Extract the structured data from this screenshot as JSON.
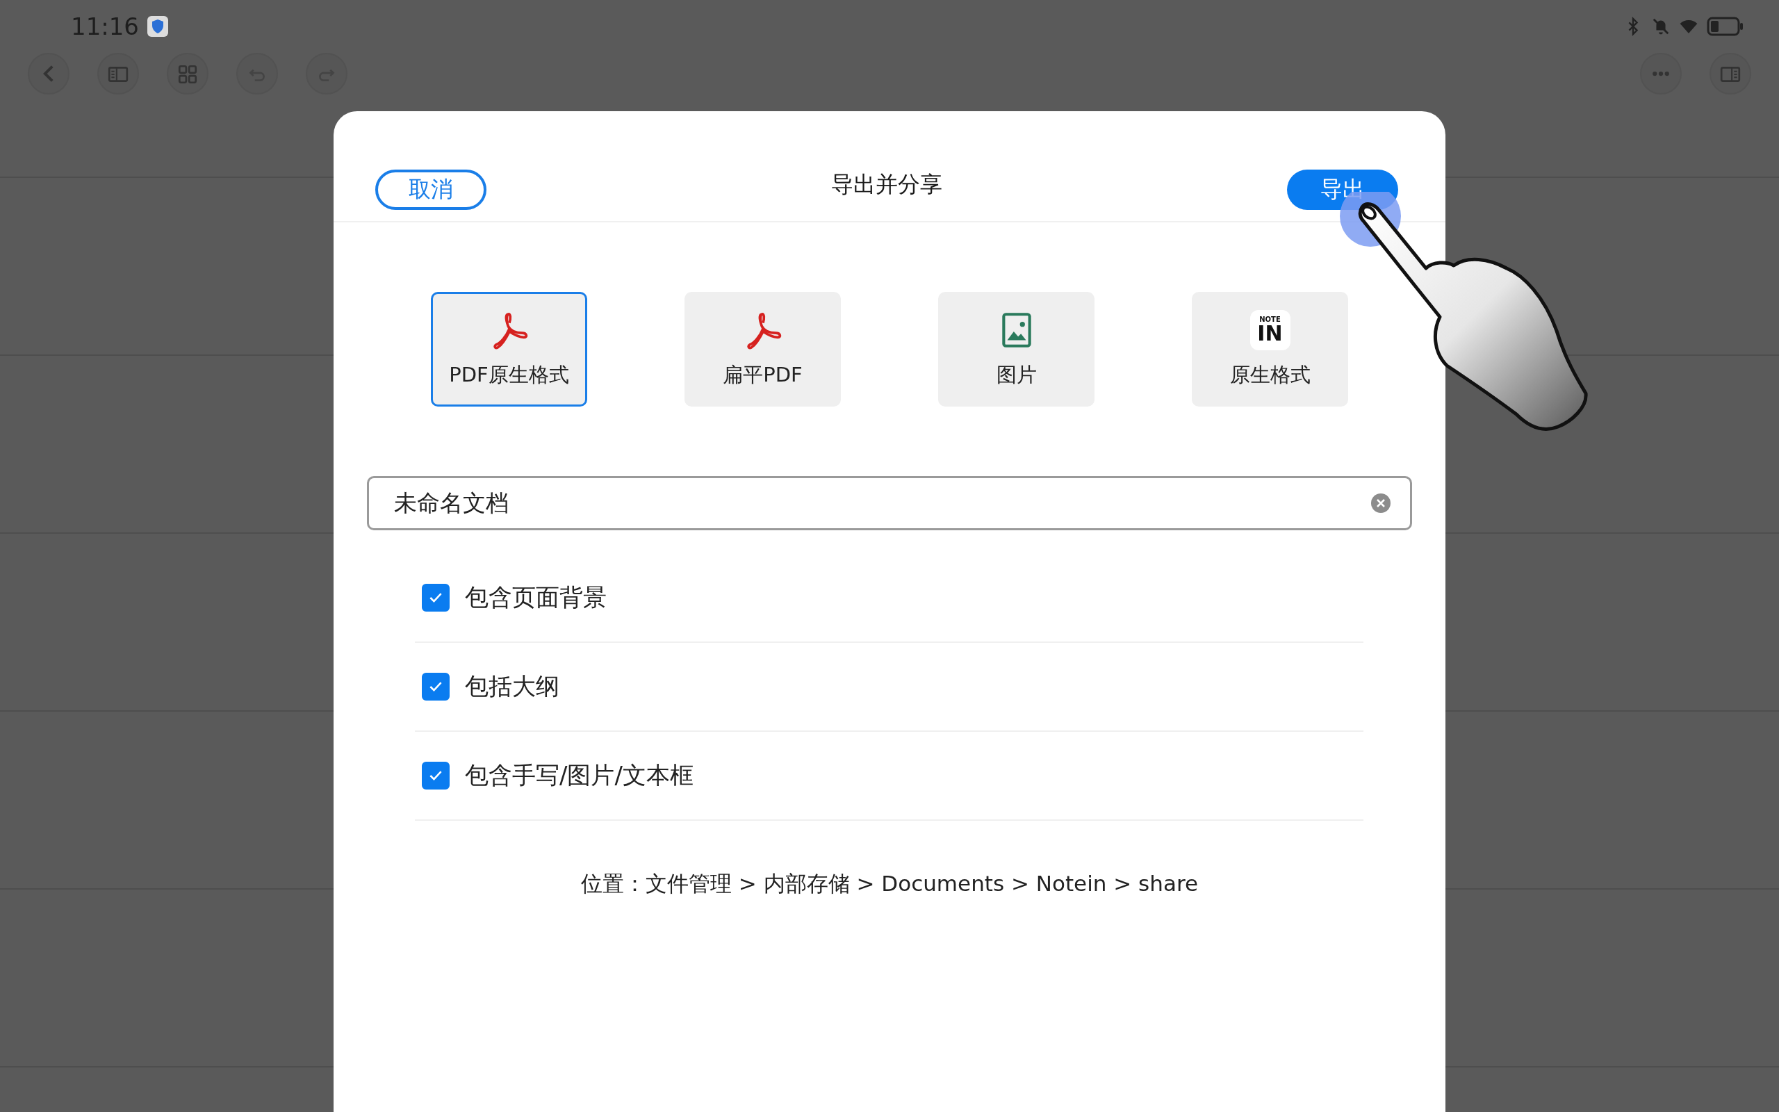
{
  "status_bar": {
    "time": "11:16"
  },
  "dialog": {
    "title": "导出并分享",
    "cancel_button": "取消",
    "export_button": "导出"
  },
  "formats": [
    {
      "kind": "pdf",
      "label": "PDF原生格式",
      "selected": true
    },
    {
      "kind": "pdf",
      "label": "扁平PDF",
      "selected": false
    },
    {
      "kind": "image",
      "label": "图片",
      "selected": false
    },
    {
      "kind": "notein",
      "label": "原生格式",
      "selected": false,
      "logo_top": "NOTE",
      "logo_main": "IN"
    }
  ],
  "filename": {
    "value": "未命名文档"
  },
  "options": [
    {
      "label": "包含页面背景",
      "checked": true
    },
    {
      "label": "包括大纲",
      "checked": true
    },
    {
      "label": "包含手写/图片/文本框",
      "checked": true
    }
  ],
  "location": "位置：文件管理 > 内部存储 > Documents > Notein > share"
}
